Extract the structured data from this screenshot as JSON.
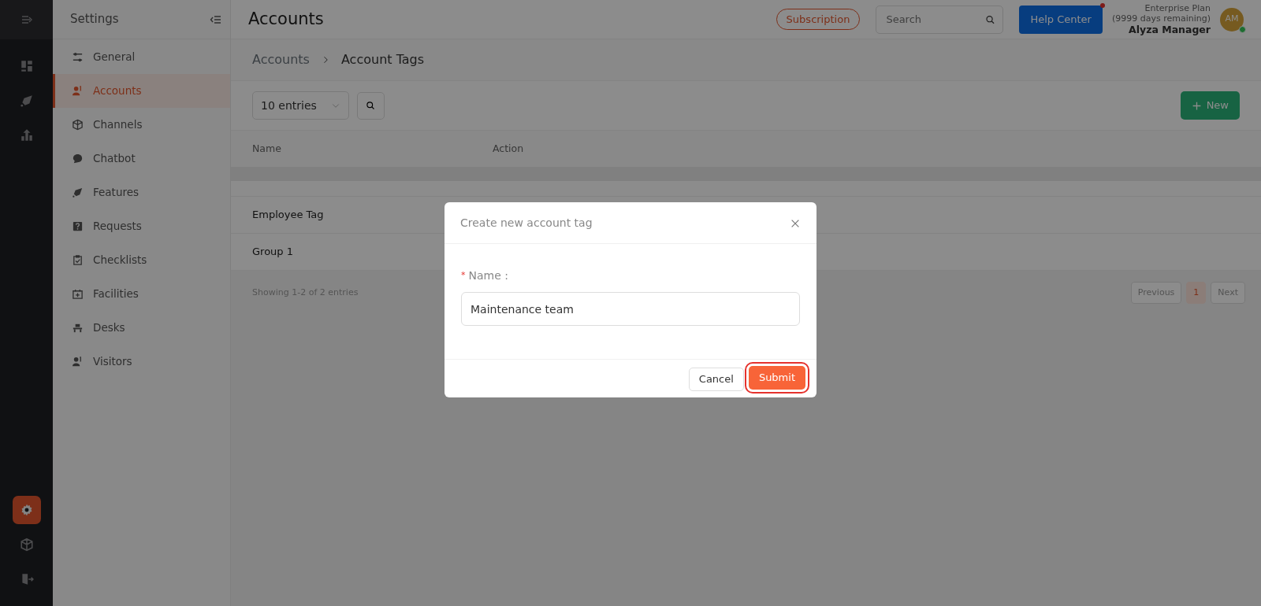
{
  "rail": {
    "items": [
      {
        "selected": false
      },
      {
        "selected": false
      },
      {
        "selected": false
      }
    ],
    "bottom_items": [
      {
        "selected": true
      },
      {
        "selected": false
      },
      {
        "selected": false
      }
    ]
  },
  "settings_sidebar": {
    "title": "Settings",
    "items": [
      {
        "label": "General",
        "selected": false
      },
      {
        "label": "Accounts",
        "selected": true
      },
      {
        "label": "Channels",
        "selected": false
      },
      {
        "label": "Chatbot",
        "selected": false
      },
      {
        "label": "Features",
        "selected": false
      },
      {
        "label": "Requests",
        "selected": false
      },
      {
        "label": "Checklists",
        "selected": false
      },
      {
        "label": "Facilities",
        "selected": false
      },
      {
        "label": "Desks",
        "selected": false
      },
      {
        "label": "Visitors",
        "selected": false
      }
    ]
  },
  "header": {
    "title": "Accounts",
    "subscription": "Subscription",
    "search": {
      "placeholder": "Search"
    },
    "help_center": "Help Center",
    "help_center_notice": true,
    "plan": "Enterprise Plan",
    "days_remaining": "(9999 days remaining)",
    "user_name": "Alyza Manager",
    "avatar_initials": "AM",
    "online": true
  },
  "breadcrumb": [
    "Accounts",
    "Account Tags"
  ],
  "toolbar": {
    "entries": "10 entries",
    "new_button": "New"
  },
  "table": {
    "columns": [
      "Name",
      "Action"
    ],
    "rows": [
      [
        "Employee Tag"
      ],
      [
        "Group 1"
      ]
    ]
  },
  "footer": {
    "showing": "Showing 1-2 of 2 entries",
    "previous": "Previous",
    "pages": [
      {
        "label": "1",
        "selected": true
      }
    ],
    "next": "Next"
  },
  "modal": {
    "title": "Create new account tag",
    "field": {
      "required_mark": "*",
      "label": "Name :",
      "value": "Maintenance team"
    },
    "cancel": "Cancel",
    "submit": "Submit",
    "submit_highlighted": true
  }
}
